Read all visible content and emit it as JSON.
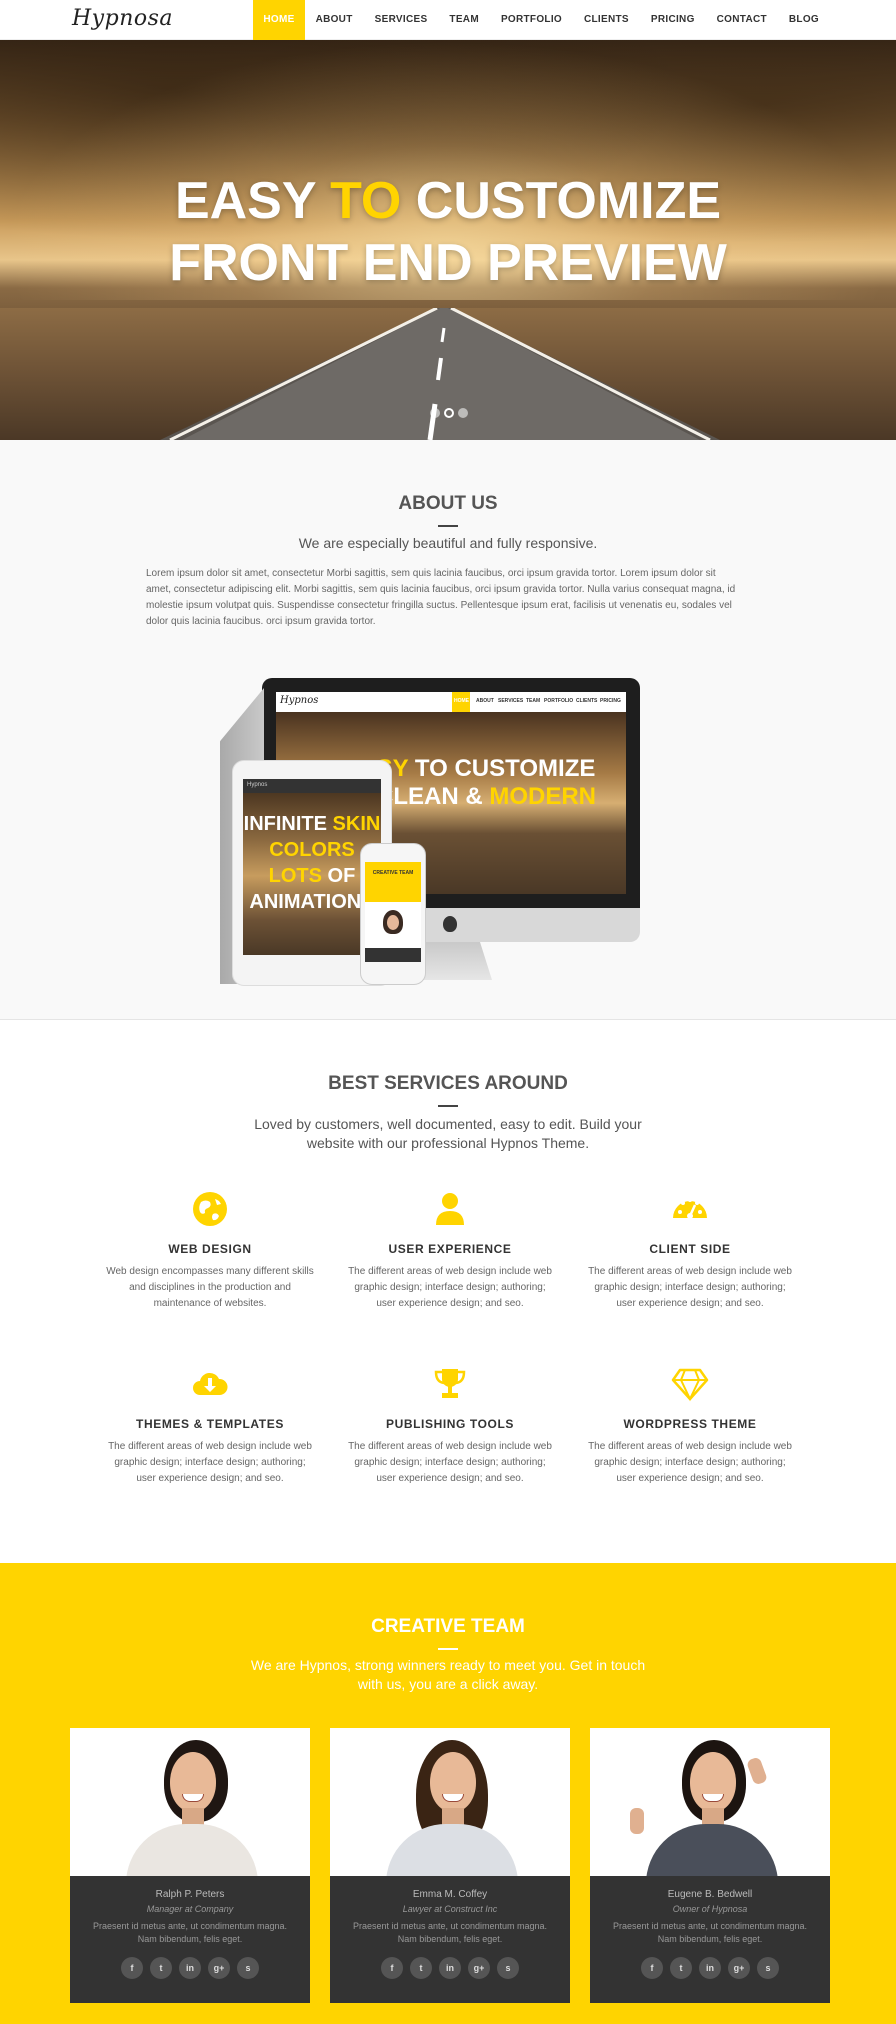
{
  "nav": {
    "logo": "Hypnosa",
    "items": [
      {
        "label": "HOME",
        "active": true
      },
      {
        "label": "ABOUT"
      },
      {
        "label": "SERVICES"
      },
      {
        "label": "TEAM"
      },
      {
        "label": "PORTFOLIO"
      },
      {
        "label": "CLIENTS"
      },
      {
        "label": "PRICING"
      },
      {
        "label": "CONTACT"
      },
      {
        "label": "BLOG"
      }
    ]
  },
  "hero": {
    "line1_a": "EASY ",
    "line1_b": "TO",
    "line1_c": " CUSTOMIZE",
    "line2": "FRONT END PREVIEW",
    "slides": 3,
    "active_slide": 2
  },
  "about": {
    "title": "ABOUT US",
    "subtitle": "We are especially beautiful and fully responsive.",
    "body": "Lorem ipsum dolor sit amet, consectetur Morbi sagittis, sem quis lacinia faucibus, orci ipsum gravida tortor. Lorem ipsum dolor sit amet, consectetur adipiscing elit. Morbi sagittis, sem quis lacinia faucibus, orci ipsum gravida tortor. Nulla varius consequat magna, id molestie ipsum volutpat quis. Suspendisse consectetur fringilla suctus. Pellentesque ipsum erat, facilisis ut venenatis eu, sodales vel dolor quis lacinia faucibus. orci ipsum gravida tortor.",
    "mockup": {
      "desktop_logo": "Hypnos",
      "desktop_menu": [
        "HOME",
        "ABOUT",
        "SERVICES",
        "TEAM",
        "PORTFOLIO",
        "CLIENTS",
        "PRICING"
      ],
      "desktop_line1_a": "SY",
      "desktop_line1_b": " TO CUSTOMIZE",
      "desktop_line2_a": "CLEAN & ",
      "desktop_line2_b": "MODERN",
      "tablet_label": "Hypnos",
      "tablet_lines": [
        {
          "a": "INFINITE ",
          "b": "SKIN"
        },
        {
          "a": "",
          "b": "COLORS"
        },
        {
          "a": "",
          "b": "LOTS",
          "c": " OF"
        },
        {
          "a": "ANIMATIONS",
          "b": ""
        }
      ],
      "phone_label": "CREATIVE TEAM"
    }
  },
  "services": {
    "title": "BEST SERVICES AROUND",
    "subtitle": "Loved by customers, well documented, easy to edit. Build your website with our professional Hypnos Theme.",
    "accent": "#ffd400",
    "items": [
      {
        "icon": "globe-icon",
        "name": "WEB DESIGN",
        "desc": "Web design encompasses many different skills and disciplines in the production and maintenance of websites."
      },
      {
        "icon": "user-icon",
        "name": "USER EXPERIENCE",
        "desc": "The different areas of web design include web graphic design; interface design; authoring; user experience design; and seo."
      },
      {
        "icon": "dashboard-icon",
        "name": "CLIENT SIDE",
        "desc": "The different areas of web design include web graphic design; interface design; authoring; user experience design; and seo."
      },
      {
        "icon": "cloud-download-icon",
        "name": "THEMES & TEMPLATES",
        "desc": "The different areas of web design include web graphic design; interface design; authoring; user experience design; and seo."
      },
      {
        "icon": "trophy-icon",
        "name": "PUBLISHING TOOLS",
        "desc": "The different areas of web design include web graphic design; interface design; authoring; user experience design; and seo."
      },
      {
        "icon": "diamond-icon",
        "name": "WORDPRESS THEME",
        "desc": "The different areas of web design include web graphic design; interface design; authoring; user experience design; and seo."
      }
    ]
  },
  "team": {
    "title": "CREATIVE TEAM",
    "subtitle": "We are Hypnos, strong winners ready to meet you. Get in touch with us, you are a click away.",
    "members": [
      {
        "name": "Ralph P. Peters",
        "role": "Manager at Company",
        "bio": "Praesent id metus ante, ut condimentum magna. Nam bibendum, felis eget."
      },
      {
        "name": "Emma M. Coffey",
        "role": "Lawyer at Construct Inc",
        "bio": "Praesent id metus ante, ut condimentum magna. Nam bibendum, felis eget."
      },
      {
        "name": "Eugene B. Bedwell",
        "role": "Owner of Hypnosa",
        "bio": "Praesent id metus ante, ut condimentum magna. Nam bibendum, felis eget."
      }
    ],
    "social_icons": [
      "f",
      "t",
      "in",
      "g+",
      "s"
    ],
    "social_names": [
      "facebook-icon",
      "twitter-icon",
      "linkedin-icon",
      "google-plus-icon",
      "skype-icon"
    ]
  }
}
